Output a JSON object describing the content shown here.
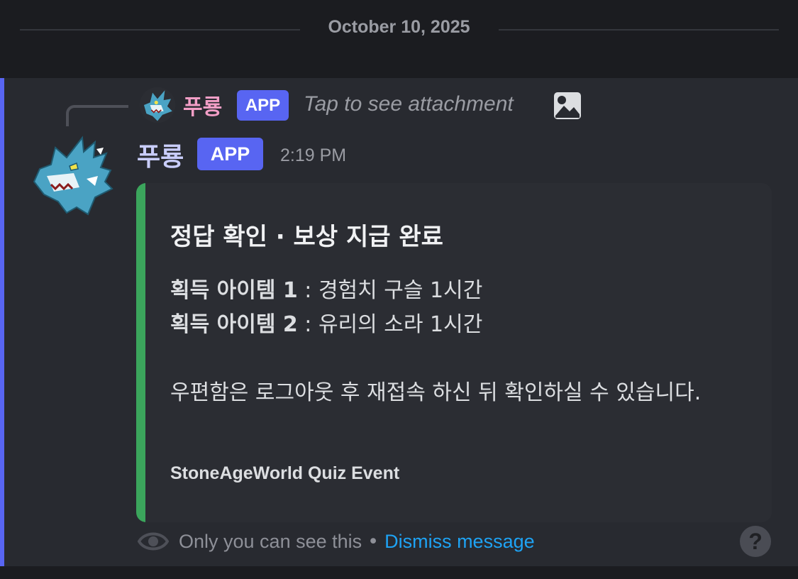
{
  "date_divider": "October 10, 2025",
  "reply": {
    "author": "푸룡",
    "tag": "APP",
    "text": "Tap to see attachment",
    "icon": "image-icon"
  },
  "message": {
    "author": "푸룡",
    "tag": "APP",
    "timestamp": "2:19 PM",
    "avatar_icon": "dragon-avatar"
  },
  "embed": {
    "accent_color": "#3ba55c",
    "title": "정답 확인 · 보상 지급 완료",
    "items": [
      {
        "label": "획득 아이템 1",
        "value": " : 경험치 구슬 1시간"
      },
      {
        "label": "획득 아이템 2",
        "value": " : 유리의 소라 1시간"
      }
    ],
    "note": "우편함은 로그아웃 후 재접속 하신 뒤 확인하실 수 있습니다.",
    "footer": "StoneAgeWorld Quiz Event"
  },
  "ephemeral": {
    "text": "Only you can see this",
    "separator": "•",
    "dismiss_label": "Dismiss message",
    "icon": "eye-icon"
  },
  "help_icon": "?"
}
